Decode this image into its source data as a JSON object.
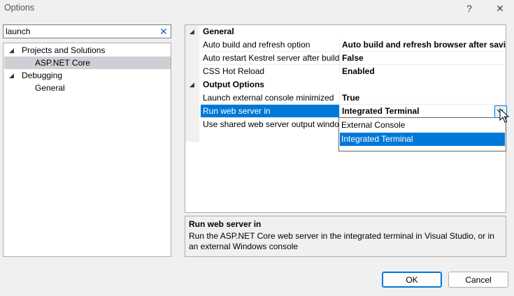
{
  "window": {
    "title": "Options",
    "help_glyph": "?",
    "close_glyph": "✕"
  },
  "search": {
    "value": "launch",
    "clear_glyph": "✕"
  },
  "tree": {
    "items": [
      {
        "label": "Projects and Solutions",
        "expanded": true
      },
      {
        "label": "ASP.NET Core",
        "selected": true
      },
      {
        "label": "Debugging",
        "expanded": true
      },
      {
        "label": "General"
      }
    ]
  },
  "grid": {
    "general_category": "General",
    "general_props": [
      {
        "name": "Auto build and refresh option",
        "value": "Auto build and refresh browser after saving changes"
      },
      {
        "name": "Auto restart Kestrel server after build",
        "value": "False"
      },
      {
        "name": "CSS Hot Reload",
        "value": "Enabled"
      }
    ],
    "output_category": "Output Options",
    "output_props": [
      {
        "name": "Launch external console minimized",
        "value": "True"
      },
      {
        "name": "Run web server in",
        "value": "Integrated Terminal"
      },
      {
        "name": "Use shared web server output window",
        "value": ""
      }
    ],
    "dropdown_options": [
      {
        "label": "External Console",
        "selected": false
      },
      {
        "label": "Integrated Terminal",
        "selected": true
      }
    ]
  },
  "description": {
    "title": "Run web server in",
    "text": "Run the ASP.NET Core web server in the integrated terminal in Visual Studio, or in an external Windows console"
  },
  "buttons": {
    "ok": "OK",
    "cancel": "Cancel"
  },
  "colors": {
    "accent": "#0078d7",
    "tree_selection": "#cfcfd6"
  }
}
